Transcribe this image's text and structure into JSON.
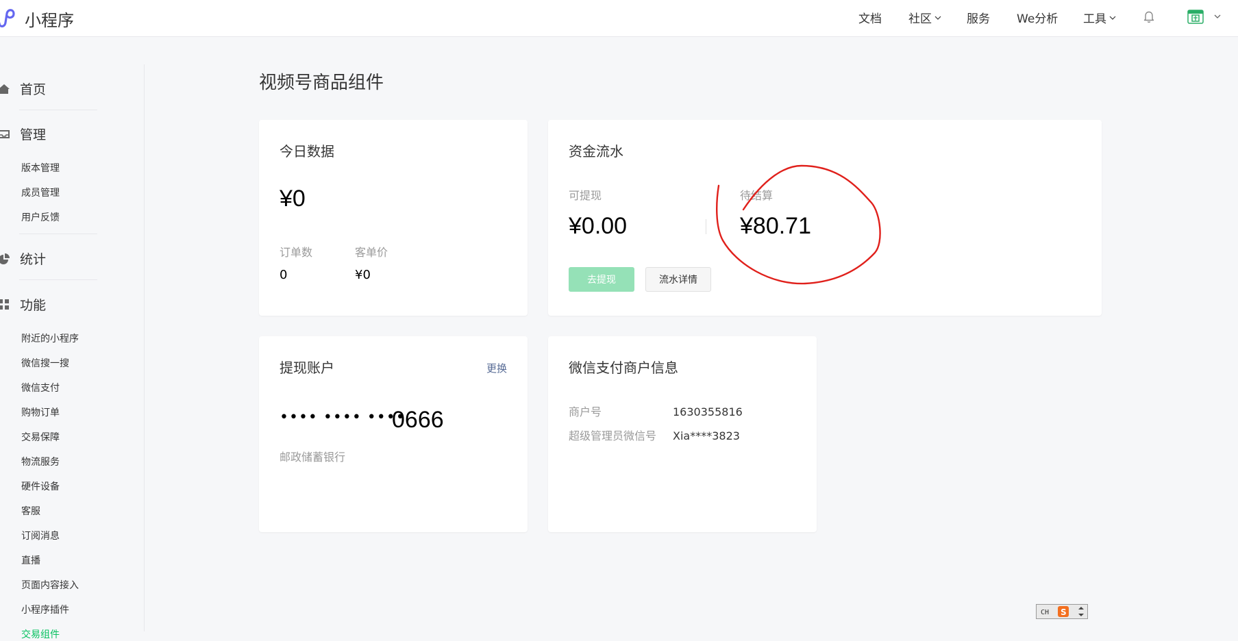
{
  "header": {
    "logo_text": "小程序",
    "nav": {
      "docs": "文档",
      "community": "社区",
      "service": "服务",
      "analytics": "We分析",
      "tools": "工具"
    }
  },
  "sidebar": {
    "home": "首页",
    "manage": {
      "label": "管理",
      "items": [
        "版本管理",
        "成员管理",
        "用户反馈"
      ]
    },
    "stats": "统计",
    "features": {
      "label": "功能",
      "items": [
        "附近的小程序",
        "微信搜一搜",
        "微信支付",
        "购物订单",
        "交易保障",
        "物流服务",
        "硬件设备",
        "客服",
        "订阅消息",
        "直播",
        "页面内容接入",
        "小程序插件",
        "交易组件"
      ]
    }
  },
  "main": {
    "page_title": "视频号商品组件",
    "today": {
      "title": "今日数据",
      "amount": "¥0",
      "orders_label": "订单数",
      "orders_value": "0",
      "avg_label": "客单价",
      "avg_value": "¥0"
    },
    "funds": {
      "title": "资金流水",
      "withdrawable_label": "可提现",
      "withdrawable_value": "¥0.00",
      "pending_label": "待结算",
      "pending_value": "¥80.71",
      "withdraw_button": "去提现",
      "details_button": "流水详情"
    },
    "account": {
      "title": "提现账户",
      "change_link": "更换",
      "masked_dots": "•••• •••• ••••",
      "last_digits": "0666",
      "bank": "邮政储蓄银行"
    },
    "merchant": {
      "title": "微信支付商户信息",
      "merchant_no_label": "商户号",
      "merchant_no_value": "1630355816",
      "admin_label": "超级管理员微信号",
      "admin_value": "Xia****3823"
    }
  },
  "ime": {
    "mode": "CH",
    "logo": "S"
  },
  "colors": {
    "accent": "#07c160",
    "link": "#576b95",
    "annotation": "#e0201b"
  }
}
